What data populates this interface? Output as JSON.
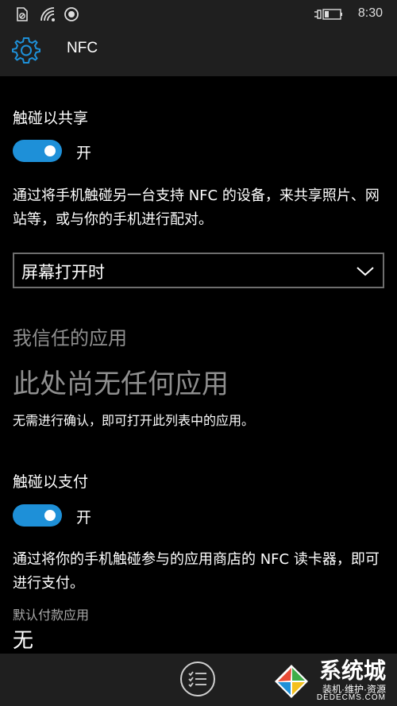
{
  "status_bar": {
    "time": "8:30"
  },
  "header": {
    "title": "NFC"
  },
  "tap_to_share": {
    "label": "触碰以共享",
    "toggle_state": "开",
    "description": "通过将手机触碰另一台支持 NFC 的设备，来共享照片、网站等，或与你的手机进行配对。",
    "dropdown_value": "屏幕打开时"
  },
  "trusted_apps": {
    "title": "我信任的应用",
    "empty_text": "此处尚无任何应用",
    "note": "无需进行确认，即可打开此列表中的应用。"
  },
  "tap_to_pay": {
    "label": "触碰以支付",
    "toggle_state": "开",
    "description": "通过将你的手机触碰参与的应用商店的 NFC 读卡器，即可进行支付。",
    "default_app_label": "默认付款应用",
    "default_app_value": "无"
  },
  "watermark": {
    "line1": "系统城",
    "line2": "装机·维护·资源",
    "line3": "DEDECMS.COM"
  },
  "colors": {
    "accent": "#1e90d8",
    "bar_bg": "#1f1f1f",
    "muted": "#8f8f8f"
  },
  "icons": {
    "status": [
      "no-sim-icon",
      "wifi-icon",
      "location-icon",
      "battery-charging-icon"
    ],
    "header": "gear-icon",
    "dropdown": "chevron-down-icon",
    "bottom": "list-icon"
  }
}
